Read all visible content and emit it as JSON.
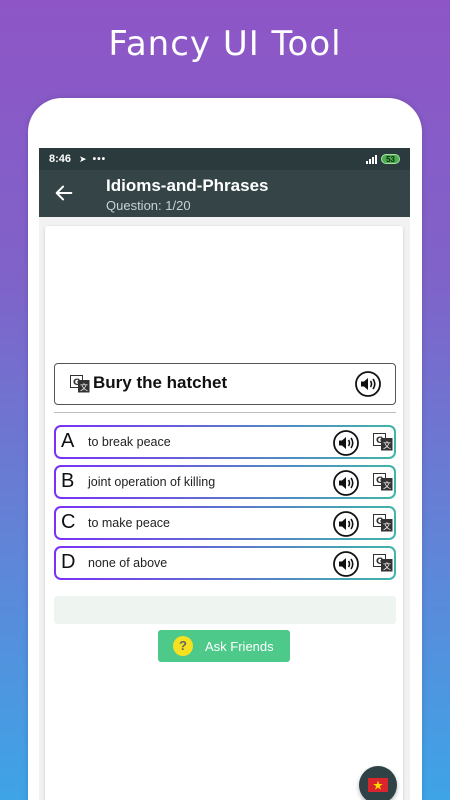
{
  "promo": {
    "title": "Fancy UI Tool"
  },
  "status": {
    "time": "8:46",
    "nav_glyph": "➤",
    "dots": "•••",
    "battery": "53"
  },
  "appbar": {
    "title": "Idioms-and-Phrases",
    "subtitle": "Question: 1/20",
    "back_icon": "arrow-left-icon"
  },
  "question": {
    "text": "Bury the hatchet"
  },
  "options": [
    {
      "letter": "A",
      "text": "to break peace"
    },
    {
      "letter": "B",
      "text": "joint operation of killing"
    },
    {
      "letter": "C",
      "text": "to make peace"
    },
    {
      "letter": "D",
      "text": "none of above"
    }
  ],
  "ask": {
    "label": "Ask Friends",
    "icon_glyph": "?"
  },
  "colors": {
    "appbar": "#344447",
    "status_bar": "#2b3a3c",
    "ask_button": "#4dca8a",
    "option_border_start": "#7b2ff7",
    "option_border_end": "#3fb6a8",
    "flag": "#d9262c"
  }
}
